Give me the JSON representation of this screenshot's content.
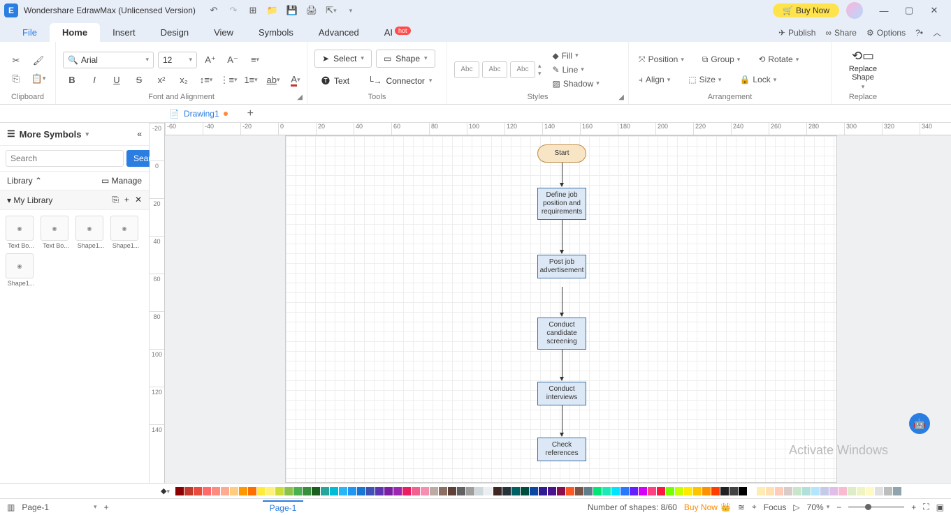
{
  "app": {
    "title": "Wondershare EdrawMax (Unlicensed Version)"
  },
  "titlebar": {
    "buy_now": "Buy Now"
  },
  "menu": {
    "file": "File",
    "home": "Home",
    "insert": "Insert",
    "design": "Design",
    "view": "View",
    "symbols": "Symbols",
    "advanced": "Advanced",
    "ai": "AI",
    "hot": "hot",
    "publish": "Publish",
    "share": "Share",
    "options": "Options"
  },
  "ribbon": {
    "clipboard_label": "Clipboard",
    "font_label": "Font and Alignment",
    "font_name": "Arial",
    "font_size": "12",
    "tools_label": "Tools",
    "select": "Select",
    "shape": "Shape",
    "text": "Text",
    "connector": "Connector",
    "styles_label": "Styles",
    "style_abc": "Abc",
    "fill": "Fill",
    "line": "Line",
    "shadow": "Shadow",
    "arrangement_label": "Arrangement",
    "position": "Position",
    "group": "Group",
    "rotate": "Rotate",
    "align": "Align",
    "size": "Size",
    "lock": "Lock",
    "replace_label": "Replace",
    "replace_shape": "Replace\nShape"
  },
  "doctab": {
    "name": "Drawing1"
  },
  "sidebar": {
    "more_symbols": "More Symbols",
    "search_ph": "Search",
    "search_btn": "Search",
    "library": "Library",
    "manage": "Manage",
    "mylib": "My Library",
    "shapes": [
      {
        "label": "Text Bo..."
      },
      {
        "label": "Text Bo..."
      },
      {
        "label": "Shape1..."
      },
      {
        "label": "Shape1..."
      },
      {
        "label": "Shape1..."
      }
    ]
  },
  "ruler_h": [
    "-60",
    "-40",
    "-20",
    "0",
    "20",
    "40",
    "60",
    "80",
    "100",
    "120",
    "140",
    "160",
    "180",
    "200",
    "220",
    "240",
    "260",
    "280",
    "300",
    "320",
    "340"
  ],
  "ruler_v": [
    "-20",
    "0",
    "20",
    "40",
    "60",
    "80",
    "100",
    "120",
    "140"
  ],
  "flowchart": {
    "start": "Start",
    "n1": "Define job position and requirements",
    "n2": "Post job advertisement",
    "n3": "Conduct candidate screening",
    "n4": "Conduct interviews",
    "n5": "Check references"
  },
  "watermark": "Activate Windows",
  "status": {
    "page_sel": "Page-1",
    "page_tab": "Page-1",
    "shapes": "Number of shapes: 8/60",
    "buy": "Buy Now",
    "focus": "Focus",
    "zoom": "70%"
  },
  "colors": [
    "#8b0000",
    "#c0392b",
    "#e74c3c",
    "#ff6b6b",
    "#ff8a80",
    "#ffab91",
    "#ffcc80",
    "#ff9800",
    "#ff6f00",
    "#ffeb3b",
    "#fff176",
    "#cddc39",
    "#8bc34a",
    "#4caf50",
    "#388e3c",
    "#1b5e20",
    "#26a69a",
    "#00bcd4",
    "#29b6f6",
    "#2196f3",
    "#1976d2",
    "#3f51b5",
    "#5e35b1",
    "#7b1fa2",
    "#9c27b0",
    "#e91e63",
    "#f06292",
    "#f48fb1",
    "#bcaaa4",
    "#8d6e63",
    "#5d4037",
    "#616161",
    "#9e9e9e",
    "#cfd8dc",
    "#eceff1",
    "#3e2723",
    "#263238",
    "#006064",
    "#004d40",
    "#0d47a1",
    "#311b92",
    "#4a148c",
    "#880e4f",
    "#ff5722",
    "#795548",
    "#607d8b",
    "#00e676",
    "#1de9b6",
    "#00e5ff",
    "#2979ff",
    "#651fff",
    "#d500f9",
    "#ff4081",
    "#ff1744",
    "#76ff03",
    "#c6ff00",
    "#ffea00",
    "#ffc400",
    "#ff9100",
    "#ff3d00",
    "#212121",
    "#424242",
    "#000000",
    "#ffffff",
    "#ffecb3",
    "#ffe0b2",
    "#ffccbc",
    "#d7ccc8",
    "#c8e6c9",
    "#b2dfdb",
    "#b3e5fc",
    "#c5cae9",
    "#e1bee7",
    "#f8bbd0",
    "#dcedc8",
    "#f0f4c3",
    "#fff9c4",
    "#e0e0e0",
    "#bdbdbd",
    "#90a4ae"
  ]
}
